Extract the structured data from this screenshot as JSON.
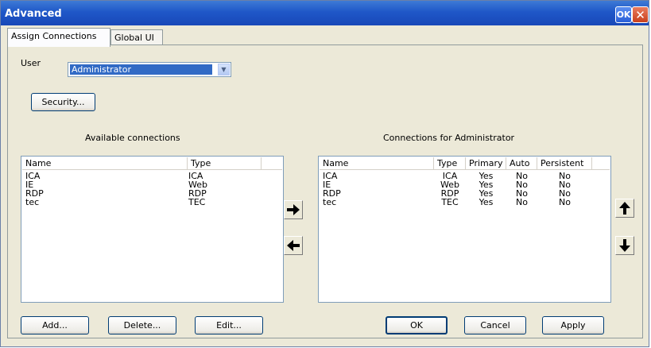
{
  "window": {
    "title": "Advanced",
    "ok_label": "OK",
    "close_glyph": "✕"
  },
  "tabs": [
    {
      "label": "Assign Connections",
      "active": true
    },
    {
      "label": "Global UI",
      "active": false
    }
  ],
  "user": {
    "label": "User",
    "value": "Administrator"
  },
  "security_button": "Security...",
  "available": {
    "title": "Available connections",
    "columns": [
      "Name",
      "Type"
    ],
    "rows": [
      [
        "ICA",
        "ICA"
      ],
      [
        "IE",
        "Web"
      ],
      [
        "RDP",
        "RDP"
      ],
      [
        "tec",
        "TEC"
      ]
    ]
  },
  "assigned": {
    "title": "Connections for Administrator",
    "columns": [
      "Name",
      "Type",
      "Primary",
      "Auto",
      "Persistent"
    ],
    "rows": [
      [
        "ICA",
        "ICA",
        "Yes",
        "No",
        "No"
      ],
      [
        "IE",
        "Web",
        "Yes",
        "No",
        "No"
      ],
      [
        "RDP",
        "RDP",
        "Yes",
        "No",
        "No"
      ],
      [
        "tec",
        "TEC",
        "Yes",
        "No",
        "No"
      ]
    ]
  },
  "buttons": {
    "add": "Add...",
    "delete": "Delete...",
    "edit": "Edit...",
    "ok": "OK",
    "cancel": "Cancel",
    "apply": "Apply"
  },
  "icons": {
    "move_right": "arrow-right-icon",
    "move_left": "arrow-left-icon",
    "move_up": "arrow-up-icon",
    "move_down": "arrow-down-icon"
  },
  "colors": {
    "titlebar": "#1f57c8",
    "selection": "#316ac5",
    "face": "#ece9d8"
  }
}
